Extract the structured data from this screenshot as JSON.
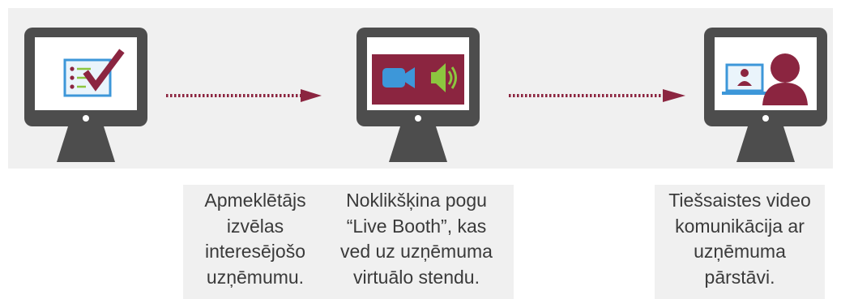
{
  "steps": [
    {
      "icon": "checklist-icon",
      "caption_lines": [
        "Apmeklētājs",
        "izvēlas",
        "interesējošo",
        "uzņēmumu."
      ]
    },
    {
      "icon": "video-audio-icon",
      "caption_lines": [
        "Noklikšķina pogu",
        "“Live Booth”, kas",
        "ved uz uzņēmuma",
        "virtuālo stendu."
      ]
    },
    {
      "icon": "video-call-person-icon",
      "caption_lines": [
        "Tiešsaistes video",
        "komunikācija ar",
        "uzņēmuma",
        "pārstāvi."
      ]
    }
  ],
  "colors": {
    "band": "#f0f0f0",
    "monitor": "#4d4d4d",
    "accent_maroon": "#8b2540",
    "blue": "#3d97d9",
    "green": "#8cc63f",
    "text": "#3a3a3a"
  }
}
